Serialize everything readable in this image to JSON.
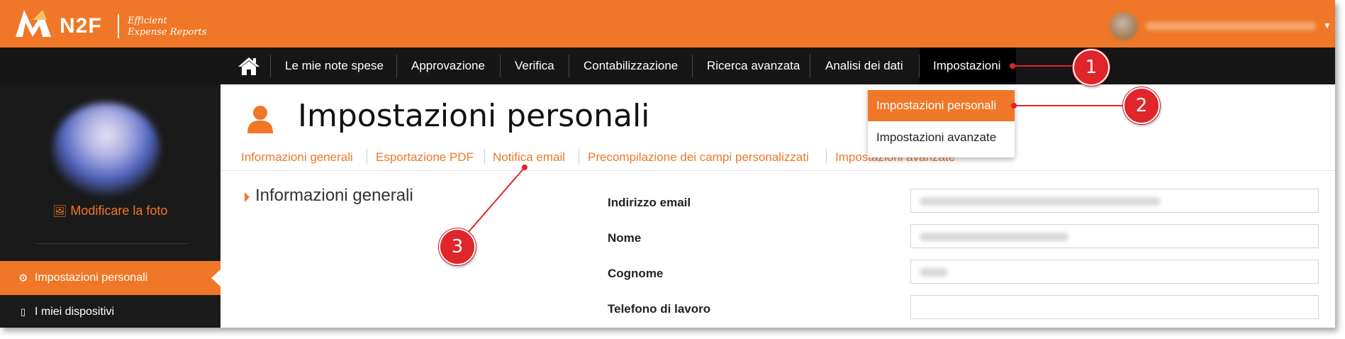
{
  "brand": {
    "logo_text": "N2F",
    "tagline_line1": "Efficient",
    "tagline_line2": "Expense Reports",
    "accent": "#f07727",
    "nav_bg": "#161616"
  },
  "nav": {
    "home_icon": "home-icon",
    "items": [
      {
        "label": "Le mie note spese"
      },
      {
        "label": "Approvazione"
      },
      {
        "label": "Verifica"
      },
      {
        "label": "Contabilizzazione"
      },
      {
        "label": "Ricerca avanzata"
      },
      {
        "label": "Analisi dei dati"
      },
      {
        "label": "Impostazioni"
      }
    ]
  },
  "dropdown": {
    "items": [
      {
        "label": "Impostazioni personali"
      },
      {
        "label": "Impostazioni avanzate"
      }
    ]
  },
  "sidebar": {
    "photo_link": "Modificare la foto",
    "items": [
      {
        "label": "Impostazioni personali",
        "icon": "gear-icon"
      },
      {
        "label": "I miei dispositivi",
        "icon": "mobile-icon"
      }
    ]
  },
  "main": {
    "title": "Impostazioni personali",
    "title_icon": "user-icon",
    "tabs": [
      {
        "label": "Informazioni generali"
      },
      {
        "label": "Esportazione PDF"
      },
      {
        "label": "Notifica email"
      },
      {
        "label": "Precompilazione dei campi personalizzati"
      },
      {
        "label": "Impostazioni avanzate"
      }
    ],
    "section_title": "Informazioni generali",
    "fields": [
      {
        "label": "Indirizzo email"
      },
      {
        "label": "Nome"
      },
      {
        "label": "Cognome"
      },
      {
        "label": "Telefono di lavoro"
      }
    ]
  },
  "callouts": [
    "1",
    "2",
    "3"
  ],
  "callout_color": "#e0252b"
}
